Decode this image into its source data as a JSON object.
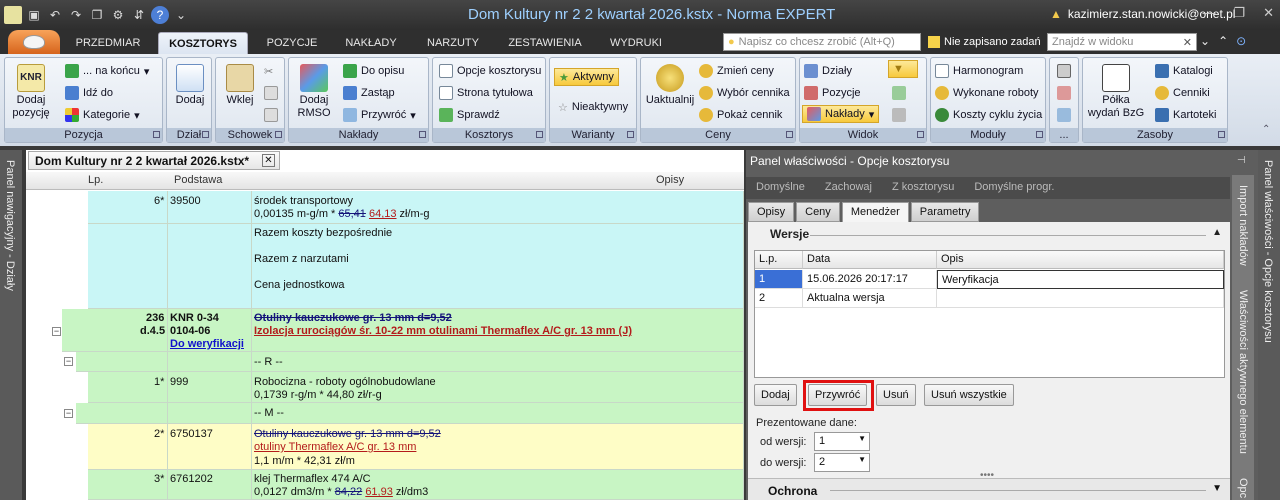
{
  "window": {
    "title": "Dom Kultury nr 2 2 kwartał 2026.kstx - Norma EXPERT",
    "user": "kazimierz.stan.nowicki@onet.pl"
  },
  "ribbon_tabs": [
    "PRZEDMIAR",
    "KOSZTORYS",
    "POZYCJE",
    "NAKŁADY",
    "NARZUTY",
    "ZESTAWIENIA",
    "WYDRUKI"
  ],
  "ribbon_search": {
    "placeholder": "Napisz co chcesz zrobić (Alt+Q)",
    "unsaved": "Nie zapisano zadań",
    "find_placeholder": "Znajdź w widoku"
  },
  "ribbon": {
    "pozycja": {
      "label": "Pozycja",
      "add": "Dodaj pozycję",
      "na_koncu": "... na końcu",
      "idz_do": "Idź do",
      "kategorie": "Kategorie"
    },
    "dzial": {
      "label": "Dział",
      "add": "Dodaj"
    },
    "schowek": {
      "label": "Schowek",
      "paste": "Wklej"
    },
    "naklady": {
      "label": "Nakłady",
      "add_rmso": "Dodaj RMSO",
      "do_opisu": "Do opisu",
      "zastap": "Zastąp",
      "przywroc": "Przywróć"
    },
    "kosztorys": {
      "label": "Kosztorys",
      "opcje": "Opcje kosztorysu",
      "strona": "Strona tytułowa",
      "sprawdz": "Sprawdź"
    },
    "warianty": {
      "label": "Warianty",
      "aktywny": "Aktywny",
      "nieaktywny": "Nieaktywny"
    },
    "ceny": {
      "label": "Ceny",
      "uaktualnij": "Uaktualnij",
      "zmien": "Zmień ceny",
      "wybor": "Wybór cennika",
      "pokaz": "Pokaż cennik"
    },
    "widok": {
      "label": "Widok",
      "dzialy": "Działy",
      "pozycje": "Pozycje",
      "naklady": "Nakłady"
    },
    "moduly": {
      "label": "Moduły",
      "harmonogram": "Harmonogram",
      "wykonane": "Wykonane roboty",
      "koszty": "Koszty cyklu życia"
    },
    "dots": {
      "label": "..."
    },
    "zasoby": {
      "label": "Zasoby",
      "polka": "Półka wydań BzG",
      "katalogi": "Katalogi",
      "cenniki": "Cenniki",
      "kartoteki": "Kartoteki"
    }
  },
  "rails": {
    "left": "Panel nawigacyjny - Działy",
    "right": "Panel właściwości - Opcje kosztorysu",
    "mid1": "Import nakładów",
    "mid2": "Właściwości aktywnego elementu",
    "mid3": "Opc"
  },
  "document": {
    "tab": "Dom Kultury nr 2 2 kwartał 2026.kstx*",
    "columns": {
      "lp": "Lp.",
      "podstawa": "Podstawa",
      "opisy": "Opisy"
    },
    "r1": {
      "lp": "6*",
      "podstawa": "39500",
      "line1": "środek transportowy",
      "line2_a": "0,00135 m-g/m * ",
      "line2_old": "65,41",
      "line2_new": "64,13",
      "line2_b": " zł/m-g"
    },
    "r2": {
      "a": "Razem koszty bezpośrednie",
      "b": "Razem z narzutami",
      "c": "Cena jednostkowa"
    },
    "r3": {
      "lp1": "236",
      "lp2": "d.4.5",
      "pod1": "KNR 0-34",
      "pod2": "0104-06",
      "pod3": "Do weryfikacji",
      "line1": "Otuliny kauczukowe gr. 13 mm d=9,52",
      "line2": "Izolacja rurociągów śr. 10-22 mm otulinami Thermaflex A/C gr. 13 mm (J)"
    },
    "r4": {
      "text": "-- R --"
    },
    "r5": {
      "lp": "1*",
      "podstawa": "999",
      "line1": "Robocizna - roboty ogólnobudowlane",
      "line2": "0,1739 r-g/m * 44,80 zł/r-g"
    },
    "r6": {
      "text": "-- M --"
    },
    "r7": {
      "lp": "2*",
      "podstawa": "6750137",
      "line1": "Otuliny kauczukowe gr. 13 mm d=9,52",
      "line2": "otuliny Thermaflex A/C gr. 13 mm",
      "line3": "1,1 m/m * 42,31 zł/m"
    },
    "r8": {
      "lp": "3*",
      "podstawa": "6761202",
      "line1": "klej Thermaflex 474 A/C",
      "line2_a": "0,0127 dm3/m * ",
      "line2_old": "84,22",
      "line2_new": "61,93",
      "line2_b": " zł/dm3"
    }
  },
  "panel": {
    "title": "Panel właściwości - Opcje kosztorysu",
    "top_actions": [
      "Domyślne",
      "Zachowaj",
      "Z kosztorysu",
      "Domyślne progr."
    ],
    "tabs": [
      "Opisy",
      "Ceny",
      "Menedżer",
      "Parametry"
    ],
    "wersje": {
      "label": "Wersje",
      "columns": [
        "L.p.",
        "Data",
        "Opis"
      ],
      "rows": [
        {
          "lp": "1",
          "data": "15.06.2026 20:17:17",
          "opis": "Weryfikacja"
        },
        {
          "lp": "2",
          "data": "Aktualna wersja",
          "opis": ""
        }
      ]
    },
    "buttons": {
      "dodaj": "Dodaj",
      "przywroc": "Przywróć",
      "usun": "Usuń",
      "usun_wszystkie": "Usuń wszystkie"
    },
    "prezentowane": {
      "label": "Prezentowane dane:",
      "od_label": "od wersji:",
      "od_value": "1",
      "do_label": "do wersji:",
      "do_value": "2"
    },
    "ochrona": "Ochrona"
  },
  "colors": {
    "highlight_box": "#e01010",
    "selected_row": "#3a6fd6",
    "title_text": "#9ed0ff"
  }
}
